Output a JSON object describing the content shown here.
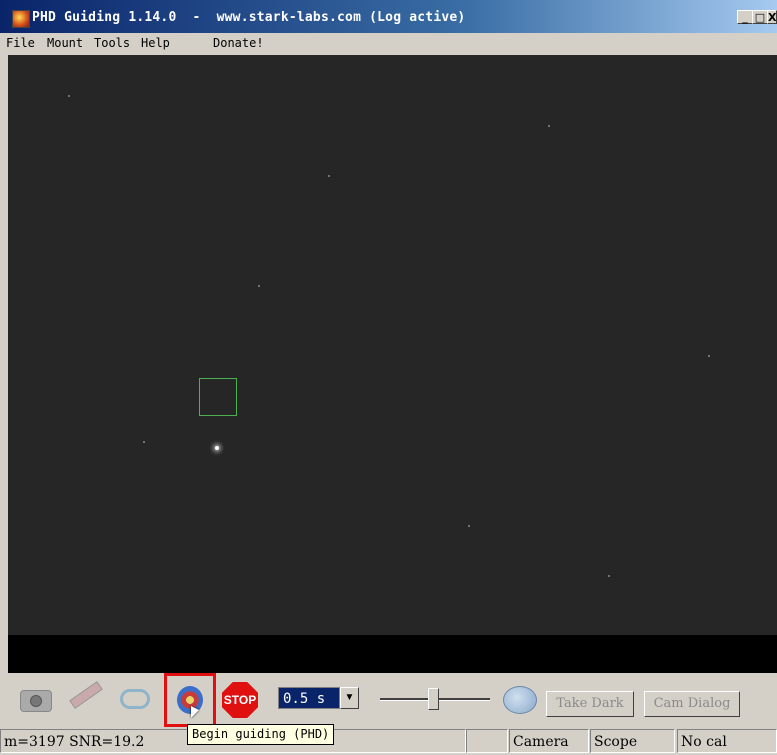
{
  "window": {
    "title": "PHD Guiding 1.14.0  -  www.stark-labs.com (Log active)",
    "minimize_label": "_",
    "maximize_label": "□",
    "close_label": "X"
  },
  "menu": {
    "items": [
      "File",
      "Mount",
      "Tools",
      "Help",
      "Donate!"
    ]
  },
  "toolbar": {
    "camera_icon": "camera-icon",
    "scope_icon": "telescope-icon",
    "loop_icon": "loop-icon",
    "guide_icon": "target-icon",
    "stop_label": "STOP",
    "exposure_value": "0.5 s",
    "exposure_arrow": "▼",
    "brain_icon": "brain-icon",
    "take_dark_label": "Take Dark",
    "cam_dialog_label": "Cam Dialog"
  },
  "tooltip": {
    "text": "Begin guiding (PHD)"
  },
  "status": {
    "left": "m=3197 SNR=19.2",
    "camera": "Camera",
    "scope": "Scope",
    "calibration": "No cal"
  },
  "colors": {
    "title_start": "#0a246a",
    "highlight_box": "#e01010",
    "star_box": "#4caf50",
    "tooltip_bg": "#ffffe1"
  }
}
